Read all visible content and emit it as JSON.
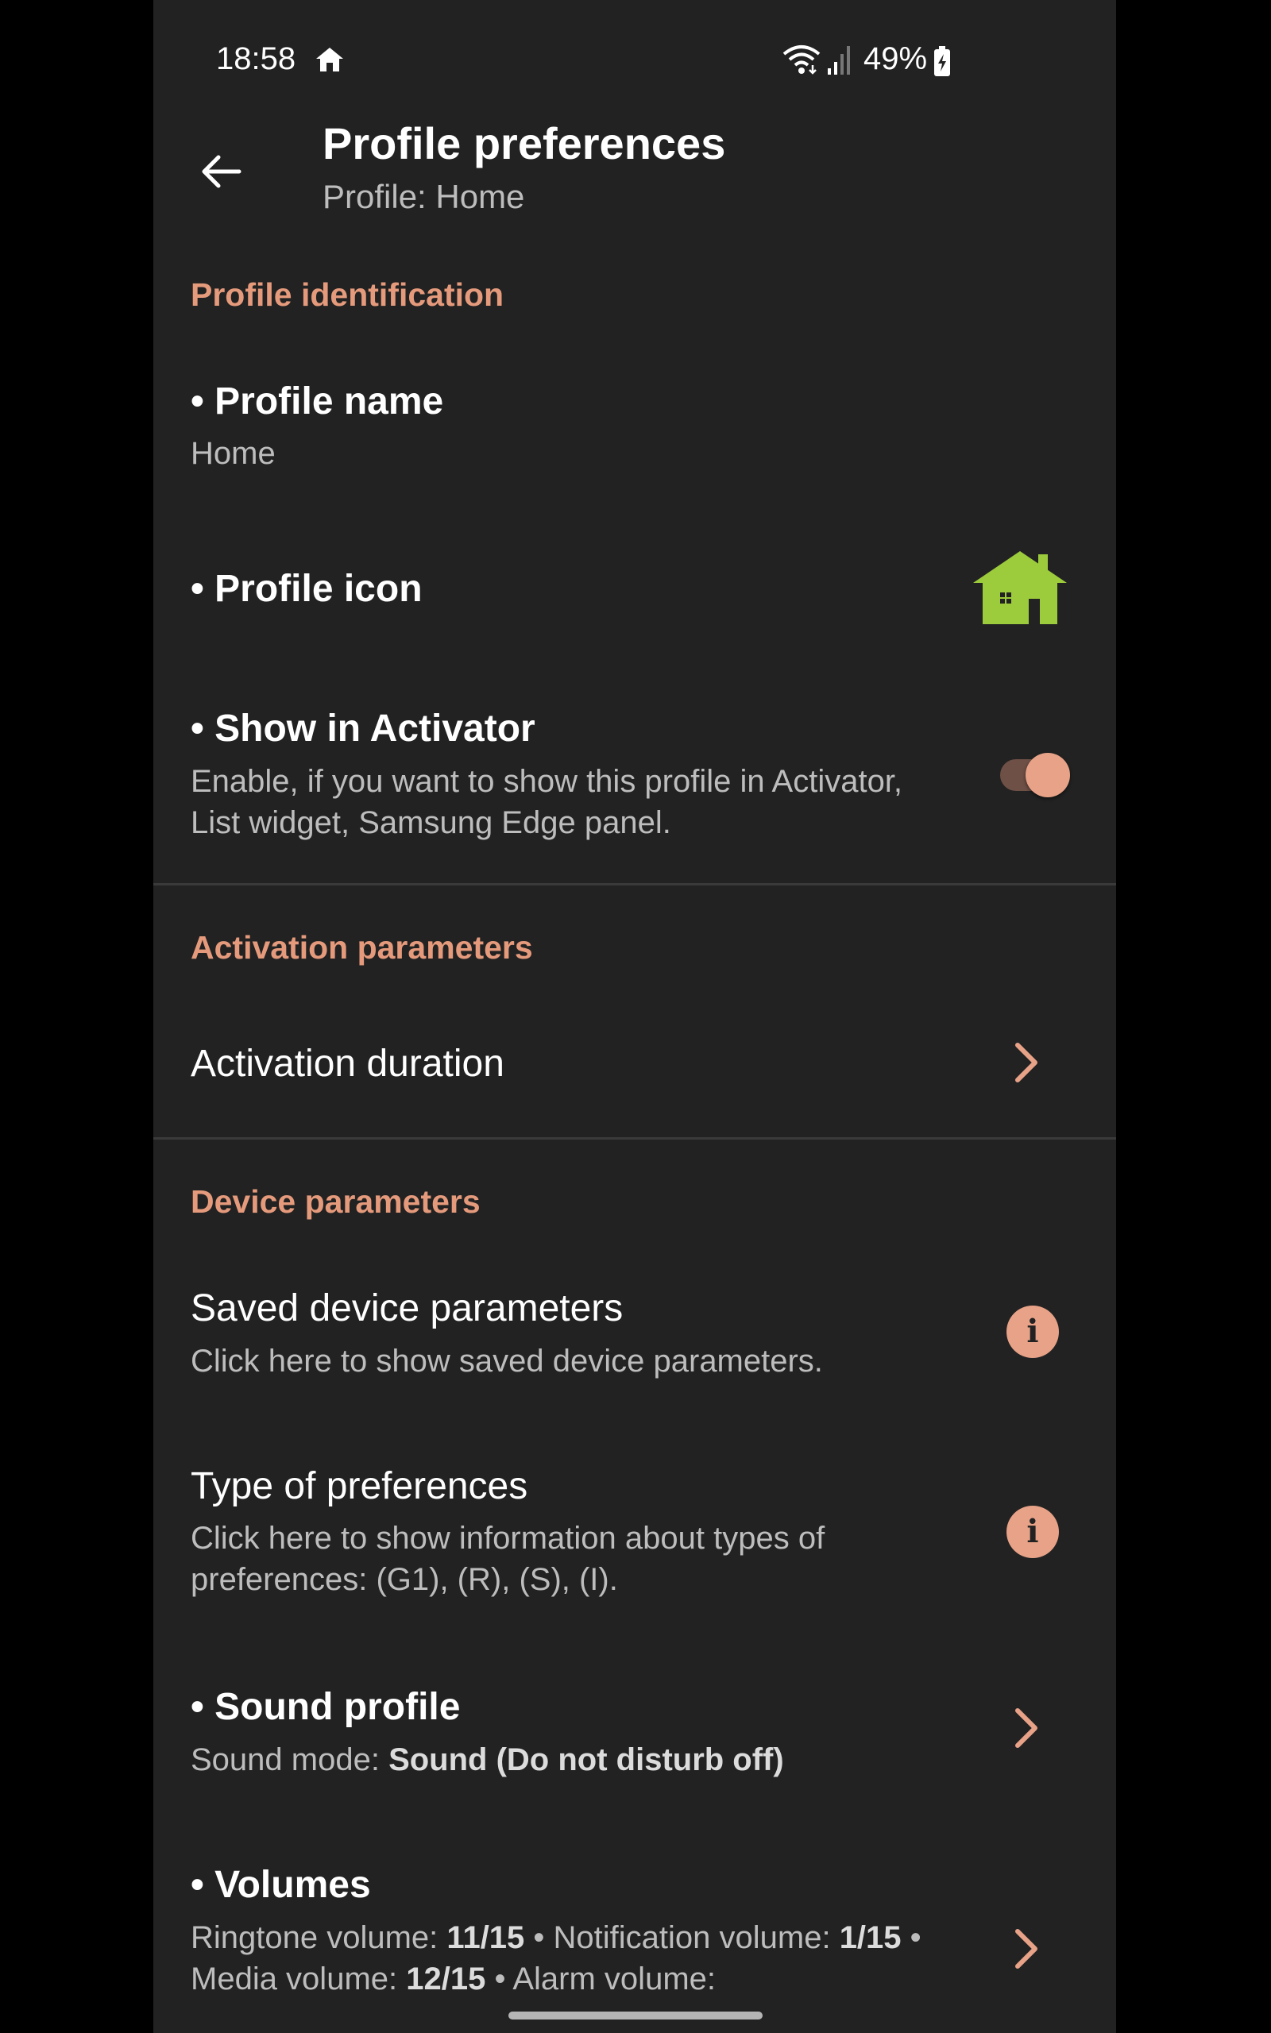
{
  "status_bar": {
    "time": "18:58",
    "battery": "49%",
    "icons": [
      "home-icon",
      "wifi-icon",
      "signal-icon",
      "battery-icon"
    ]
  },
  "header": {
    "title": "Profile preferences",
    "subtitle": "Profile: Home"
  },
  "sections": {
    "identification": {
      "header": "Profile identification",
      "profile_name": {
        "title": "• Profile name",
        "value": "Home"
      },
      "profile_icon": {
        "title": "• Profile icon",
        "icon": "green-house-icon"
      },
      "show_in_activator": {
        "title": "• Show in Activator",
        "summary": "Enable, if you want to show this profile in Activator, List widget, Samsung Edge panel.",
        "enabled": true
      }
    },
    "activation": {
      "header": "Activation parameters",
      "activation_duration": {
        "title": "Activation duration"
      }
    },
    "device": {
      "header": "Device parameters",
      "saved_params": {
        "title": "Saved device parameters",
        "summary": "Click here to show saved device parameters."
      },
      "type_of_prefs": {
        "title": "Type of preferences",
        "summary": "Click here to show information about types of preferences: (G1), (R), (S), (I)."
      },
      "sound_profile": {
        "title": "• Sound profile",
        "summary_label": "Sound mode: ",
        "summary_value": "Sound (Do not disturb off)"
      },
      "volumes": {
        "title": "• Volumes",
        "ringtone_label": "Ringtone volume: ",
        "ringtone_value": "11/15",
        "notification_label": " • Notification volume: ",
        "notification_value": "1/15",
        "media_label": " • Media volume: ",
        "media_value": "12/15",
        "alarm_label": " • Alarm volume:"
      }
    }
  },
  "colors": {
    "background": "#222222",
    "accent": "#e59a7c",
    "house_green": "#9ccc3c"
  }
}
